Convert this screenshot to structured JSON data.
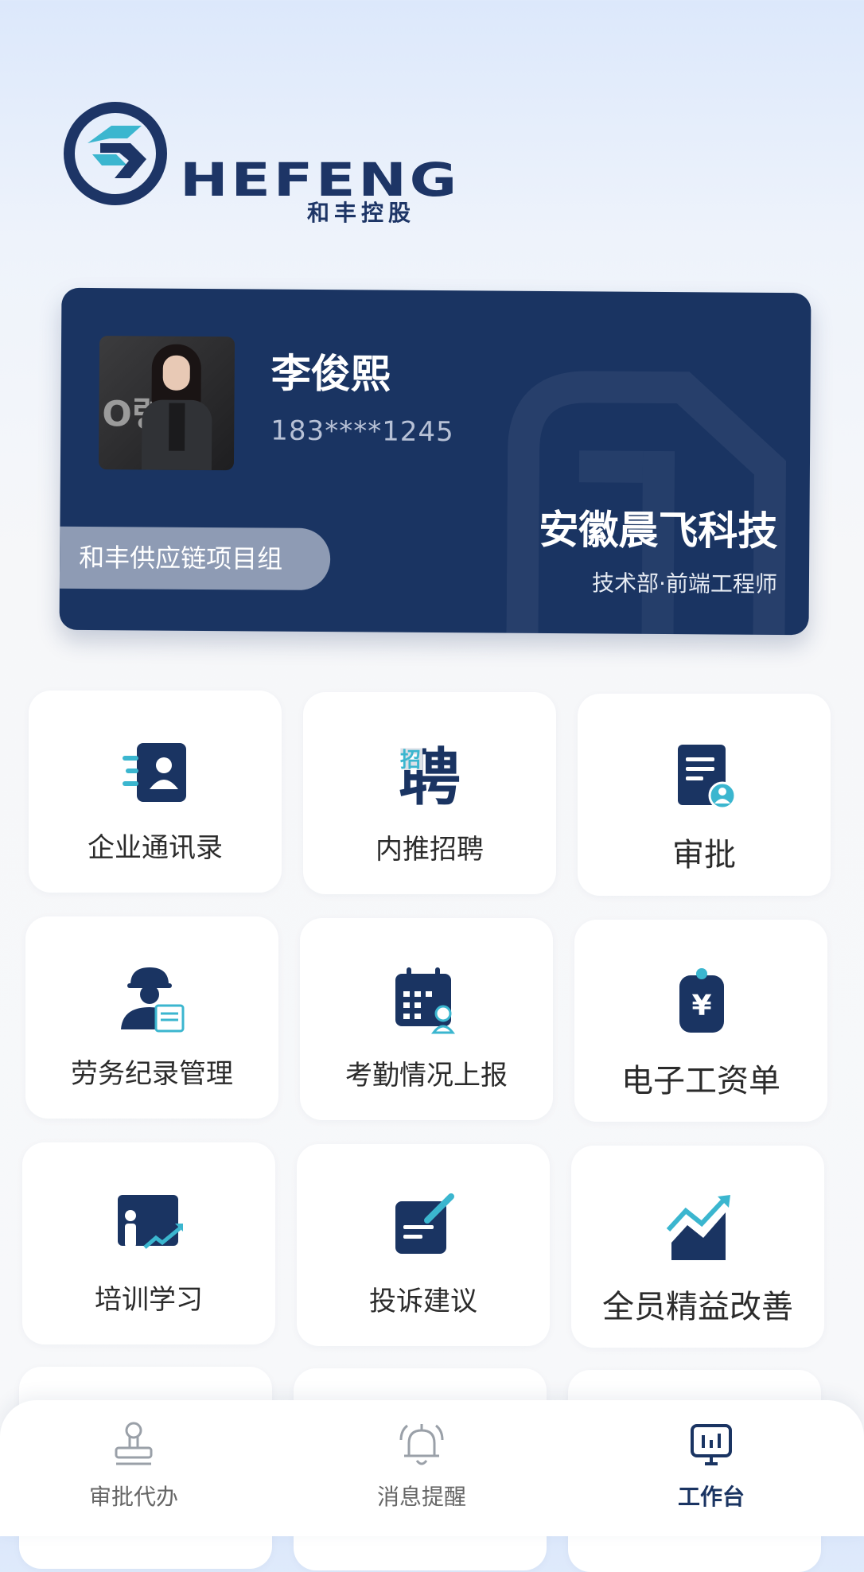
{
  "logo": {
    "wordmark": "HEFENG",
    "chinese": "和丰控股"
  },
  "profile": {
    "name": "李俊熙",
    "phone": "183****1245",
    "company": "安徽晨飞科技",
    "department": "技术部·前端工程师",
    "group": "和丰供应链项目组",
    "avatar_text": "O령"
  },
  "apps": [
    {
      "label": "企业通讯录",
      "icon": "contacts-icon"
    },
    {
      "label": "内推招聘",
      "icon": "recruit-icon",
      "icon_text": "聘",
      "icon_subtext": "招"
    },
    {
      "label": "审批",
      "icon": "approval-doc-icon"
    },
    {
      "label": "劳务纪录管理",
      "icon": "worker-icon"
    },
    {
      "label": "考勤情况上报",
      "icon": "attendance-calendar-icon"
    },
    {
      "label": "电子工资单",
      "icon": "payslip-icon",
      "icon_text": "¥"
    },
    {
      "label": "培训学习",
      "icon": "training-icon"
    },
    {
      "label": "投诉建议",
      "icon": "complaint-icon"
    },
    {
      "label": "全员精益改善",
      "icon": "improvement-chart-icon"
    }
  ],
  "nav": [
    {
      "label": "审批代办",
      "icon": "stamp-icon",
      "active": false
    },
    {
      "label": "消息提醒",
      "icon": "bell-icon",
      "active": false
    },
    {
      "label": "工作台",
      "icon": "workbench-icon",
      "active": true
    }
  ],
  "colors": {
    "primary": "#1a3462",
    "accent": "#3bb6cf",
    "background": "#f7f8fa"
  }
}
